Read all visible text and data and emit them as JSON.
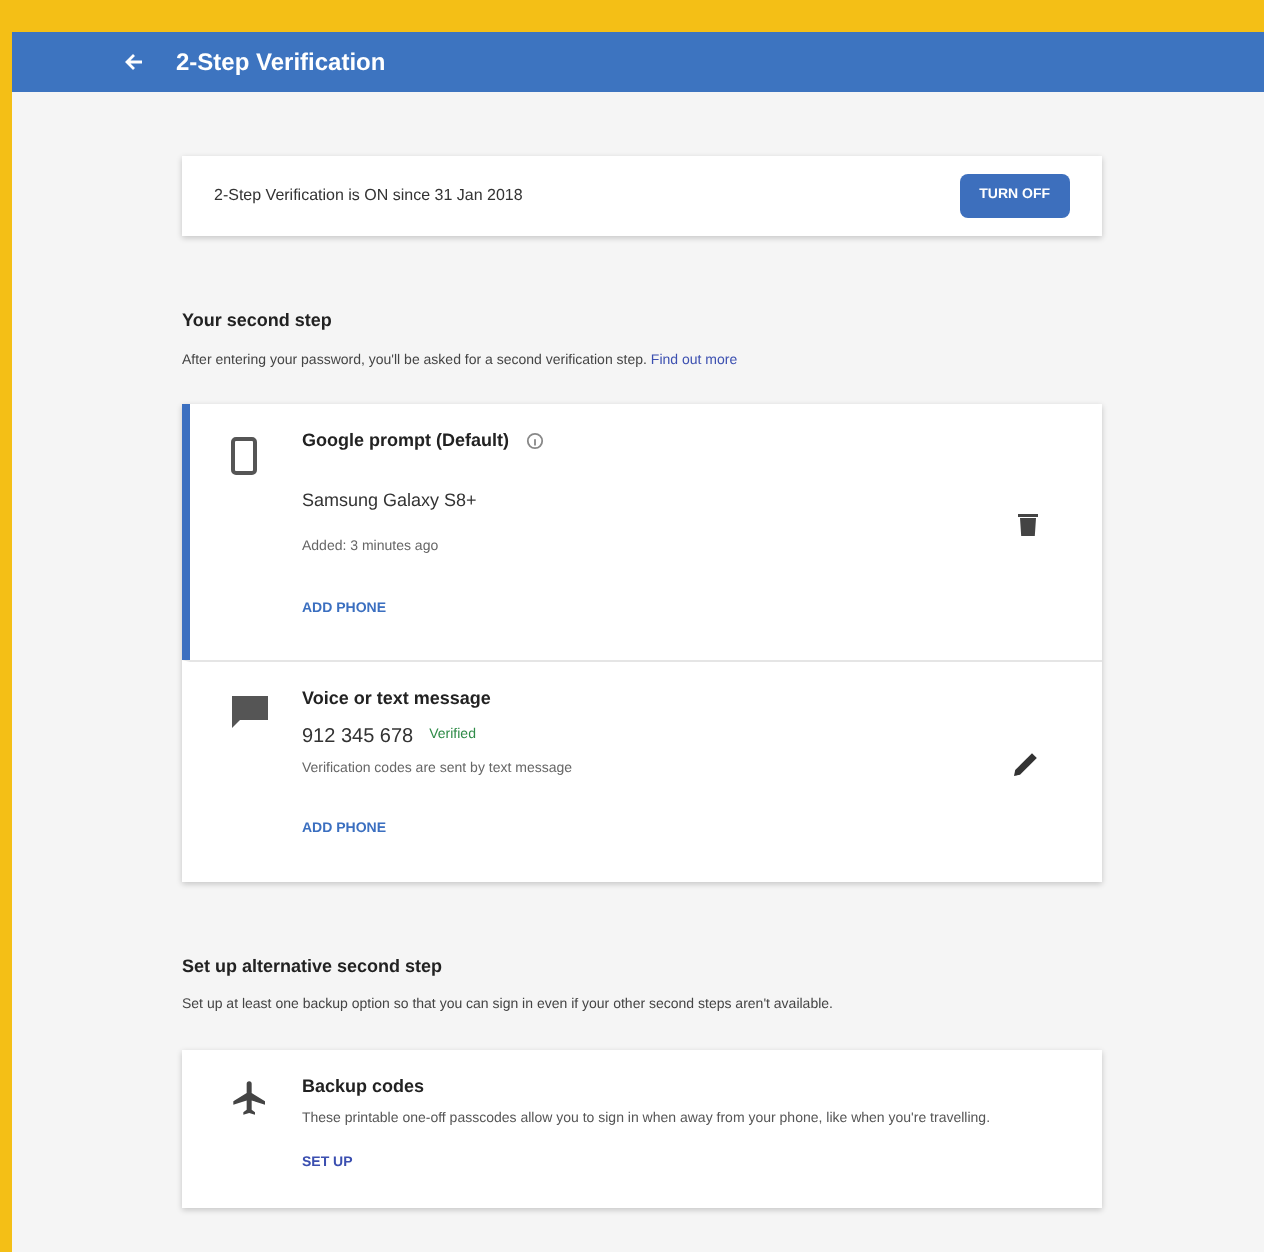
{
  "app_bar": {
    "title": "2-Step Verification"
  },
  "status_card": {
    "text": "2-Step Verification is ON since 31 Jan 2018",
    "button": "TURN OFF"
  },
  "second_step": {
    "heading": "Your second step",
    "description": "After entering your password, you'll be asked for a second verification step.",
    "link": "Find out more",
    "methods": [
      {
        "kind": "prompt",
        "title": "Google prompt (Default)",
        "device": "Samsung Galaxy S8+",
        "added": "Added: 3 minutes ago",
        "action": "ADD PHONE",
        "default": true
      },
      {
        "kind": "sms",
        "title": "Voice or text message",
        "number": "912 345 678",
        "badge": "Verified",
        "note": "Verification codes are sent by text message",
        "action": "ADD PHONE",
        "default": false
      }
    ]
  },
  "alternative": {
    "heading": "Set up alternative second step",
    "description": "Set up at least one backup option so that you can sign in even if your other second steps aren't available.",
    "options": [
      {
        "title": "Backup codes",
        "description": "These printable one-off passcodes allow you to sign in when away from your phone, like when you're travelling.",
        "action": "SET UP"
      }
    ]
  }
}
